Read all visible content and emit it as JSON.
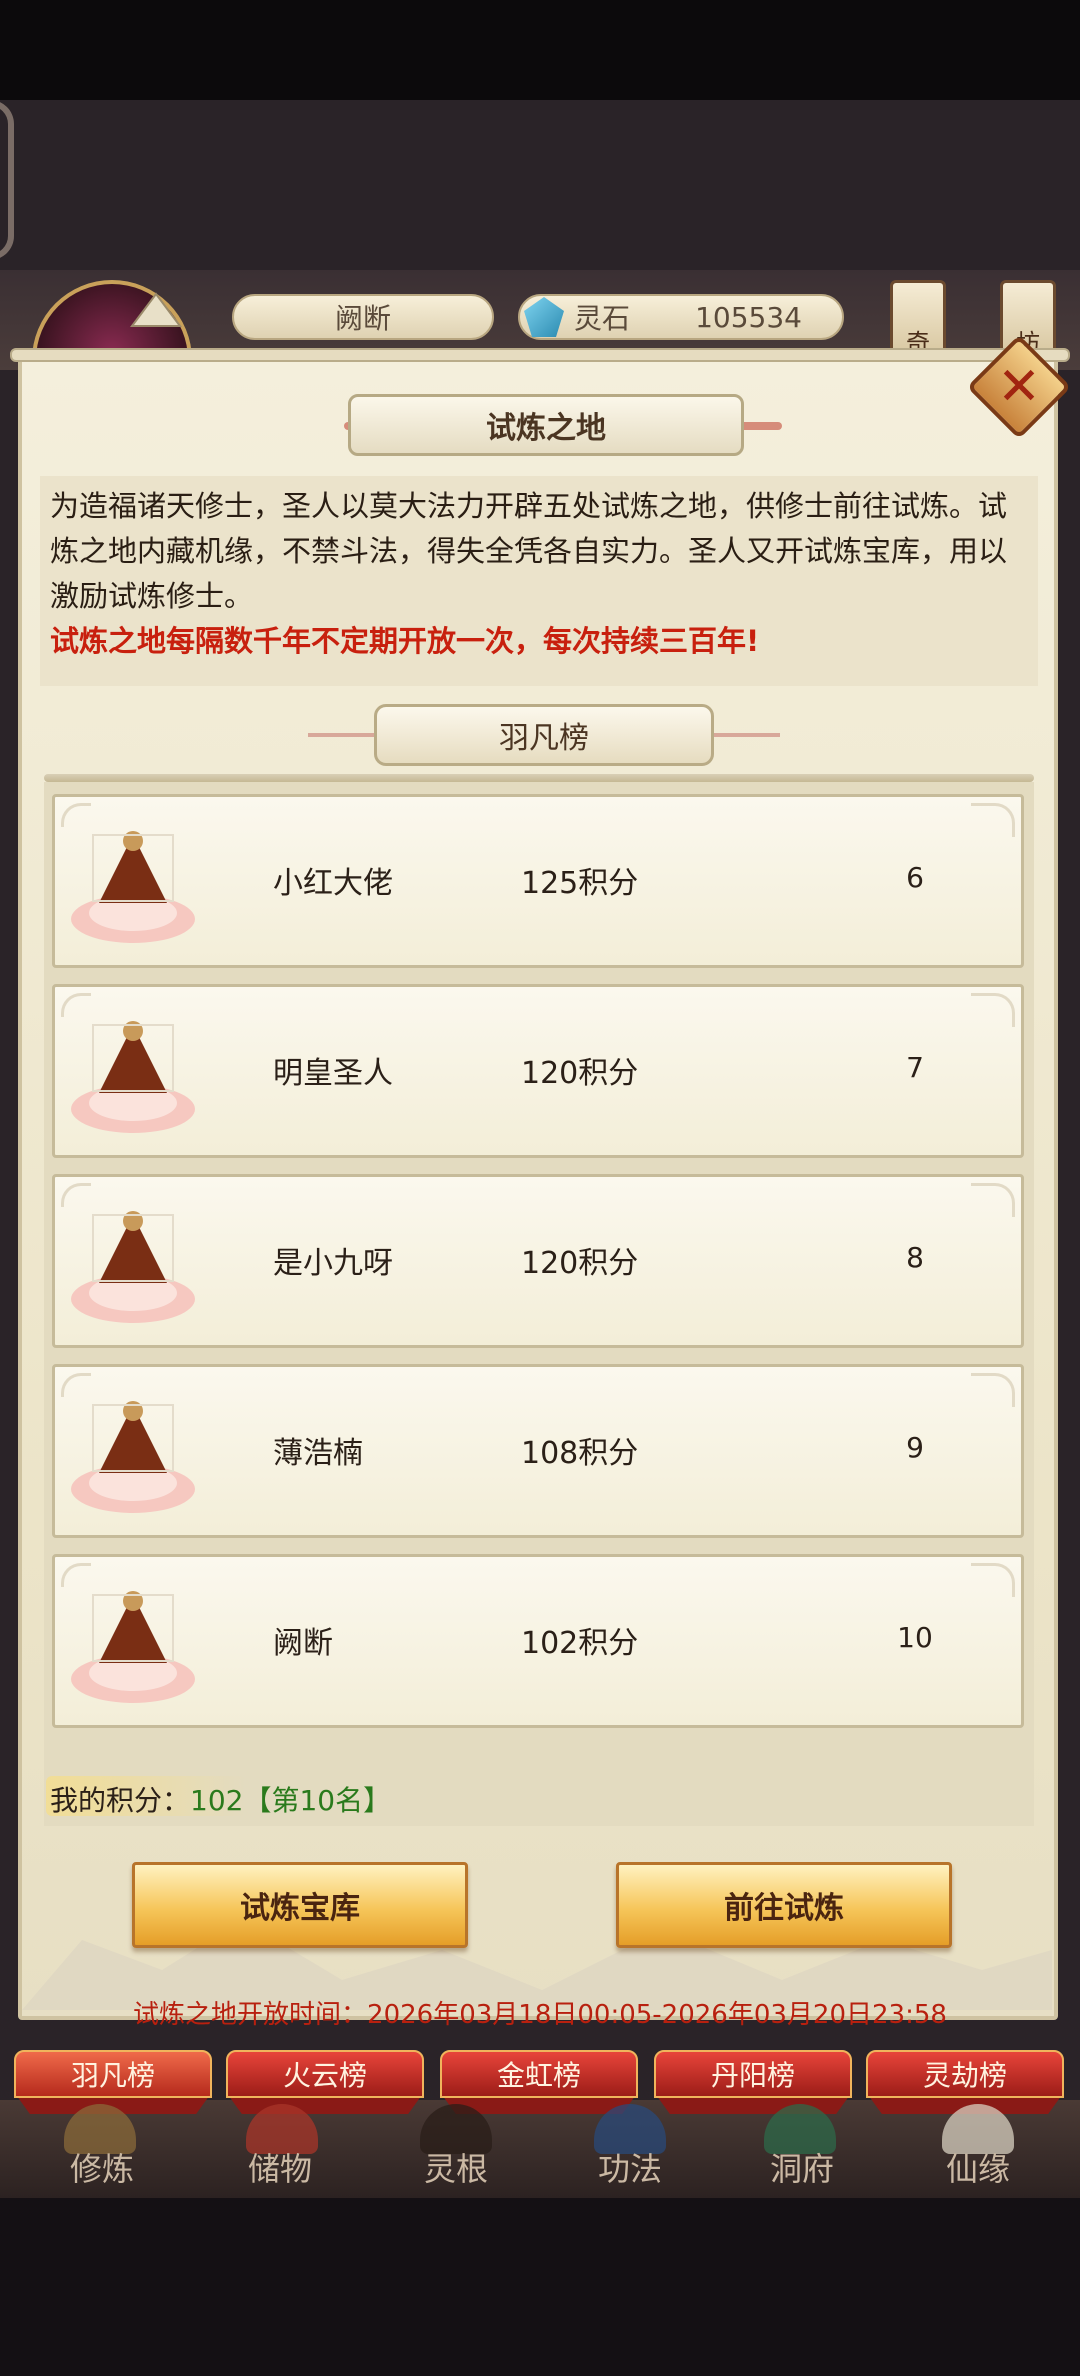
{
  "header": {
    "player_name": "阙断",
    "currency_label": "灵石",
    "currency_value": "105534",
    "side_tags": [
      "奇",
      "坊"
    ]
  },
  "dialog": {
    "title": "试炼之地",
    "intro_text": "为造福诸天修士，圣人以莫大法力开辟五处试炼之地，供修士前往试炼。试炼之地内藏机缘，不禁斗法，得失全凭各自实力。圣人又开试炼宝库，用以激励试炼修士。",
    "intro_highlight": "试炼之地每隔数千年不定期开放一次，每次持续三百年!",
    "leaderboard_title": "羽凡榜",
    "ranks": [
      {
        "name": "小红大佬",
        "score": "125积分",
        "rank": "6"
      },
      {
        "name": "明皇圣人",
        "score": "120积分",
        "rank": "7"
      },
      {
        "name": "是小九呀",
        "score": "120积分",
        "rank": "8"
      },
      {
        "name": "薄浩楠",
        "score": "108积分",
        "rank": "9"
      },
      {
        "name": "阙断",
        "score": "102积分",
        "rank": "10"
      }
    ],
    "my_score_label": "我的积分：",
    "my_score_value": "102",
    "my_rank_text": "【第10名】",
    "treasury_button": "试炼宝库",
    "go_button": "前往试炼",
    "open_time": "试炼之地开放时间：2026年03月18日00:05-2026年03月20日23:58"
  },
  "board_tabs": [
    "羽凡榜",
    "火云榜",
    "金虹榜",
    "丹阳榜",
    "灵劫榜"
  ],
  "nav": [
    "修炼",
    "储物",
    "灵根",
    "功法",
    "洞府",
    "仙缘"
  ],
  "colors": {
    "accent_red": "#c8200e",
    "score_green": "#2a7a1c",
    "gold_button": "#f6c65a",
    "parchment": "#f4efdc"
  }
}
